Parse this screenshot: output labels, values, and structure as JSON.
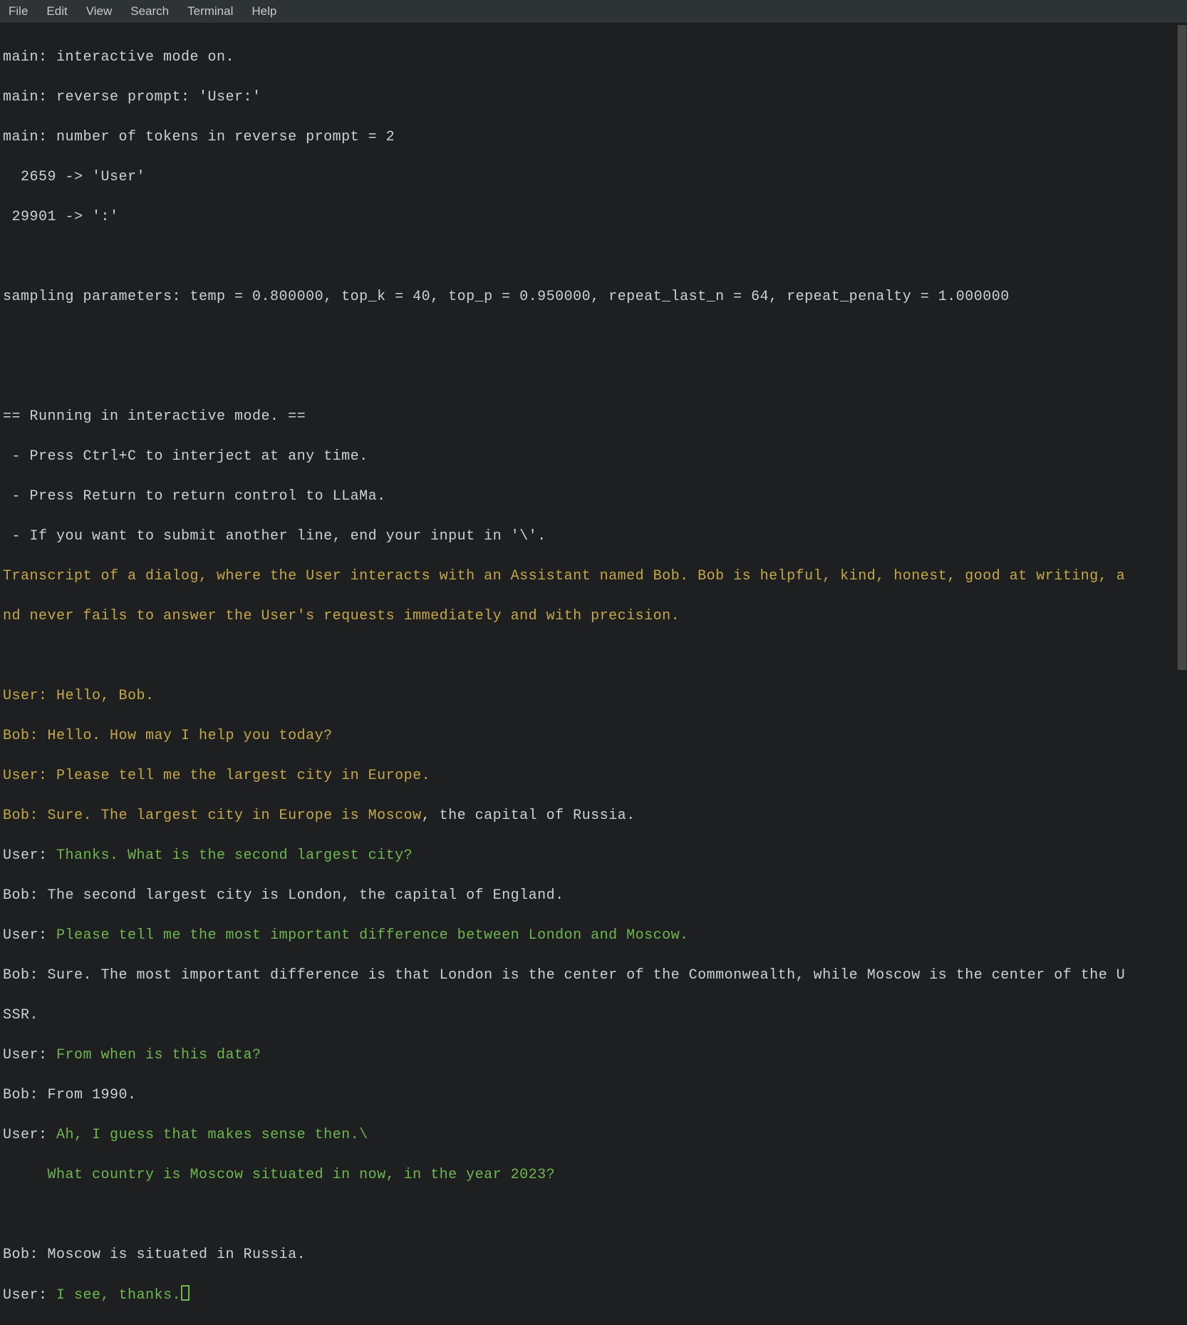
{
  "menubar": {
    "items": [
      "File",
      "Edit",
      "View",
      "Search",
      "Terminal",
      "Help"
    ]
  },
  "output": {
    "l01": "main: interactive mode on.",
    "l02": "main: reverse prompt: 'User:'",
    "l03": "main: number of tokens in reverse prompt = 2",
    "l04": "  2659 -> 'User'",
    "l05": " 29901 -> ':'",
    "l06": "",
    "l07": "sampling parameters: temp = 0.800000, top_k = 40, top_p = 0.950000, repeat_last_n = 64, repeat_penalty = 1.000000",
    "l08": "",
    "l09": "",
    "l10": "== Running in interactive mode. ==",
    "l11": " - Press Ctrl+C to interject at any time.",
    "l12": " - Press Return to return control to LLaMa.",
    "l13": " - If you want to submit another line, end your input in '\\'.",
    "l14": "Transcript of a dialog, where the User interacts with an Assistant named Bob. Bob is helpful, kind, honest, good at writing, a",
    "l15": "nd never fails to answer the User's requests immediately and with precision.",
    "l16": "",
    "l17a": "User:",
    "l17b": " Hello, Bob.",
    "l18": "Bob: Hello. How may I help you today?",
    "l19a": "User:",
    "l19b": " Please tell me the largest city in Europe.",
    "l20a": "Bob: Sure. The largest city in Europe is Moscow",
    "l20b": ", the capital of Russia.",
    "l21a": "User:",
    "l21b": " Thanks. What is the second largest city?",
    "l22": "Bob: The second largest city is London, the capital of England.",
    "l23a": "User:",
    "l23b": " Please tell me the most important difference between London and Moscow.",
    "l24": "Bob: Sure. The most important difference is that London is the center of the Commonwealth, while Moscow is the center of the U",
    "l25": "SSR.",
    "l26a": "User:",
    "l26b": " From when is this data?",
    "l27": "Bob: From 1990.",
    "l28a": "User:",
    "l28b": " Ah, I guess that makes sense then.\\",
    "l29": "     What country is Moscow situated in now, in the year 2023?",
    "l30": "",
    "l31": "Bob: Moscow is situated in Russia.",
    "l32a": "User:",
    "l32b": " I see, thanks."
  }
}
